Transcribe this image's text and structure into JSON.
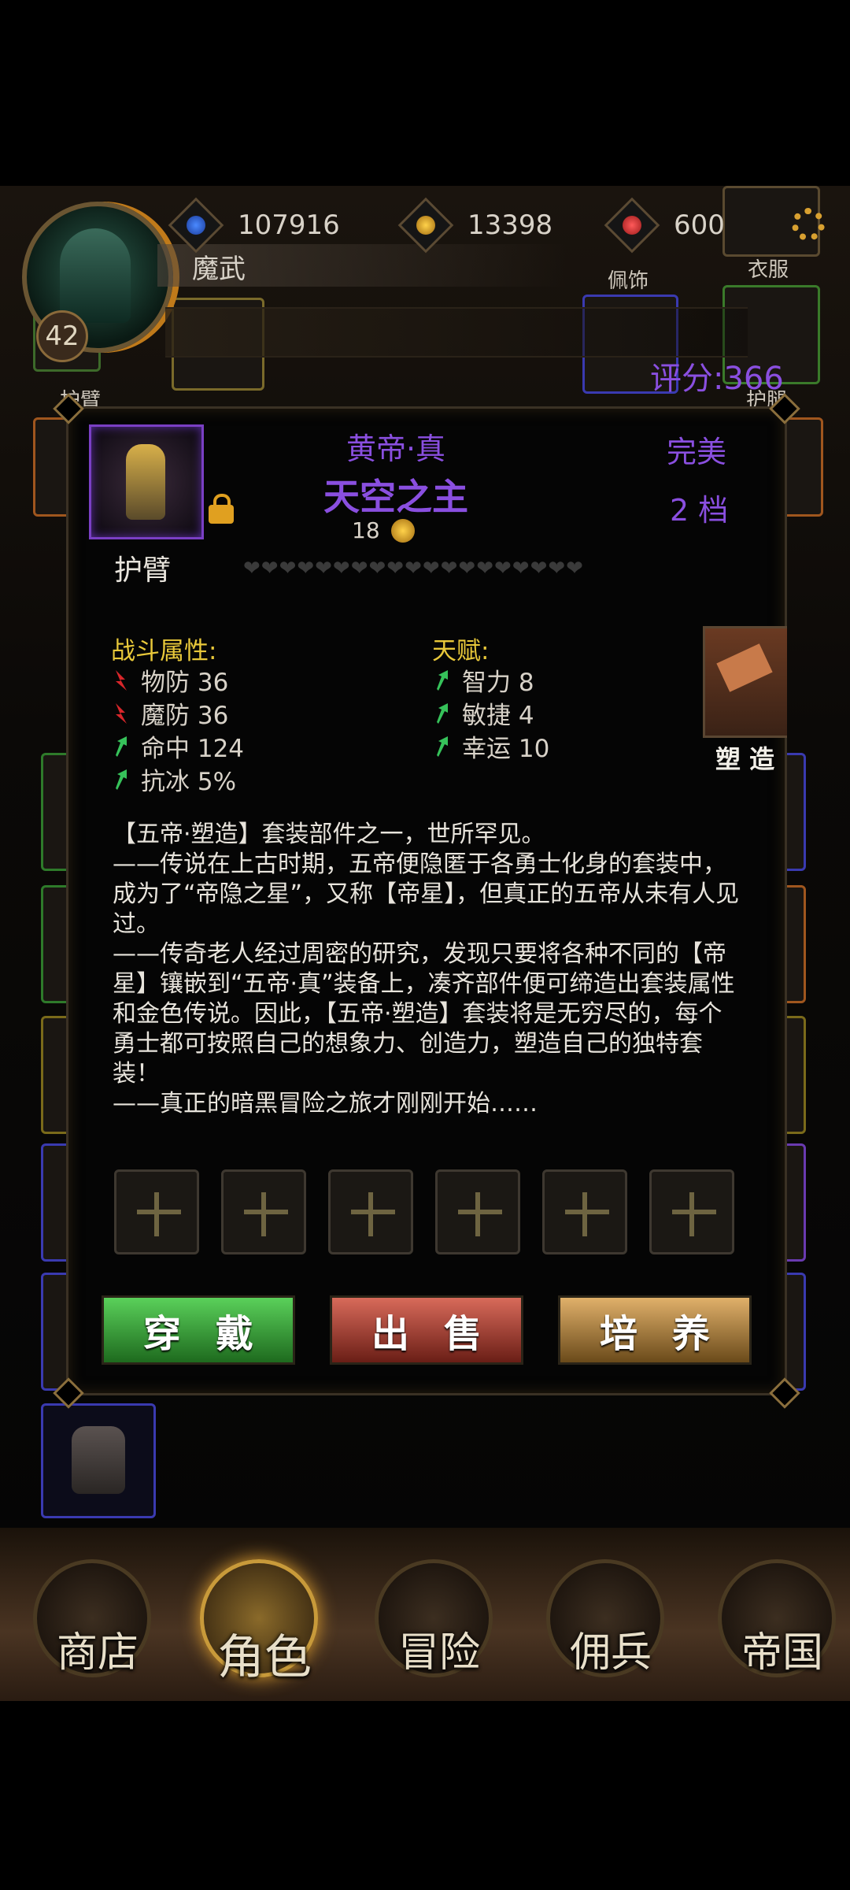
{
  "player": {
    "name": "魔武",
    "level": "42",
    "score_label": "评分:366"
  },
  "currency": {
    "blue_gems": "107916",
    "gold": "13398",
    "red_gems": "600"
  },
  "equip_slots": {
    "accessory": "佩饰",
    "clothes": "衣服",
    "armguard_top": "护臂",
    "legguard": "护腿"
  },
  "item": {
    "set_name": "黄帝·真",
    "name": "天空之主",
    "quality": "完美",
    "grade": "2 档",
    "price": "18",
    "slot_type": "护臂",
    "forge_label": "塑 造",
    "locked": true
  },
  "combat_attrs": {
    "title": "战斗属性:",
    "items": [
      {
        "label": "物防 36",
        "dir": "down"
      },
      {
        "label": "魔防 36",
        "dir": "down"
      },
      {
        "label": "命中 124",
        "dir": "up"
      },
      {
        "label": "抗冰 5%",
        "dir": "up"
      }
    ]
  },
  "talents": {
    "title": "天赋:",
    "items": [
      {
        "label": "智力 8",
        "dir": "up"
      },
      {
        "label": "敏捷 4",
        "dir": "up"
      },
      {
        "label": "幸运 10",
        "dir": "up"
      }
    ]
  },
  "description": [
    "【五帝·塑造】套装部件之一，世所罕见。",
    "——传说在上古时期，五帝便隐匿于各勇士化身的套装中，成为了“帝隐之星”，又称【帝星】，但真正的五帝从未有人见过。",
    "——传奇老人经过周密的研究，发现只要将各种不同的【帝星】镶嵌到“五帝·真”装备上，凑齐部件便可缔造出套装属性和金色传说。因此，【五帝·塑造】套装将是无穷尽的，每个勇士都可按照自己的想象力、创造力，塑造自己的独特套装！",
    "——真正的暗黑冒险之旅才刚刚开始……"
  ],
  "gem_slots": 6,
  "actions": {
    "equip": "穿戴",
    "sell": "出售",
    "train": "培养"
  },
  "nav": [
    {
      "label": "商店"
    },
    {
      "label": "角色"
    },
    {
      "label": "冒险"
    },
    {
      "label": "佣兵"
    },
    {
      "label": "帝国"
    }
  ],
  "colors": {
    "purple": "#8a4fe0",
    "gold_text": "#e8c83a",
    "arrow_up": "#36c25a",
    "arrow_down": "#d8262a",
    "btn_green": "#3aa83a",
    "btn_red": "#a83a2a",
    "btn_gold": "#b88a3a"
  }
}
